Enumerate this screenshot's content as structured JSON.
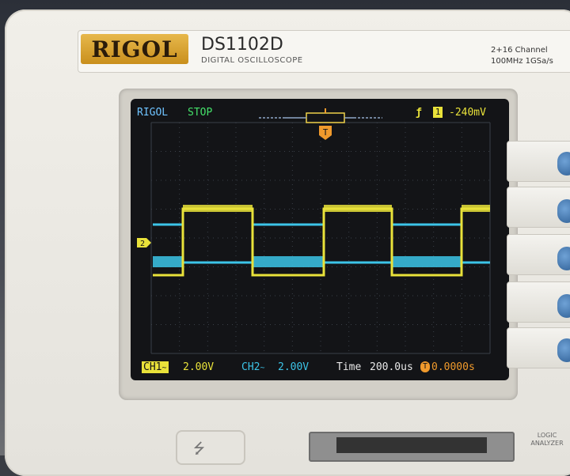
{
  "brand": {
    "logo": "RIGOL",
    "model": "DS1102D",
    "model_subtitle": "DIGITAL OSCILLOSCOPE",
    "spec_line1": "2+16 Channel",
    "spec_line2": "100MHz 1GSa/s"
  },
  "screen": {
    "top_bar": {
      "brand": "RIGOL",
      "run_state": "STOP",
      "trigger_edge_glyph": "ƒ",
      "trigger_source": "1",
      "trigger_level": "-240mV"
    },
    "markers": {
      "trigger_position": "T",
      "ch2_ground_marker": "2"
    },
    "bottom_bar": {
      "ch1_label": "CH1",
      "ch1_coupling_glyph": "~",
      "ch1_scale": "2.00V",
      "ch2_label": "CH2",
      "ch2_coupling_glyph": "~",
      "ch2_scale": "2.00V",
      "time_label": "Time",
      "time_scale": "200.0us",
      "trigger_offset_icon": "T",
      "trigger_offset": "0.0000s"
    },
    "colors": {
      "ch1": "#e9e23a",
      "ch2": "#3cc4e8",
      "text_blue": "#6fc3ff",
      "text_green": "#45e06a",
      "trigger_orange": "#f09a2c"
    }
  },
  "front_panel": {
    "logic_analyzer_label": "LOGIC ANALYZER",
    "usb_icon": "usb-icon"
  }
}
